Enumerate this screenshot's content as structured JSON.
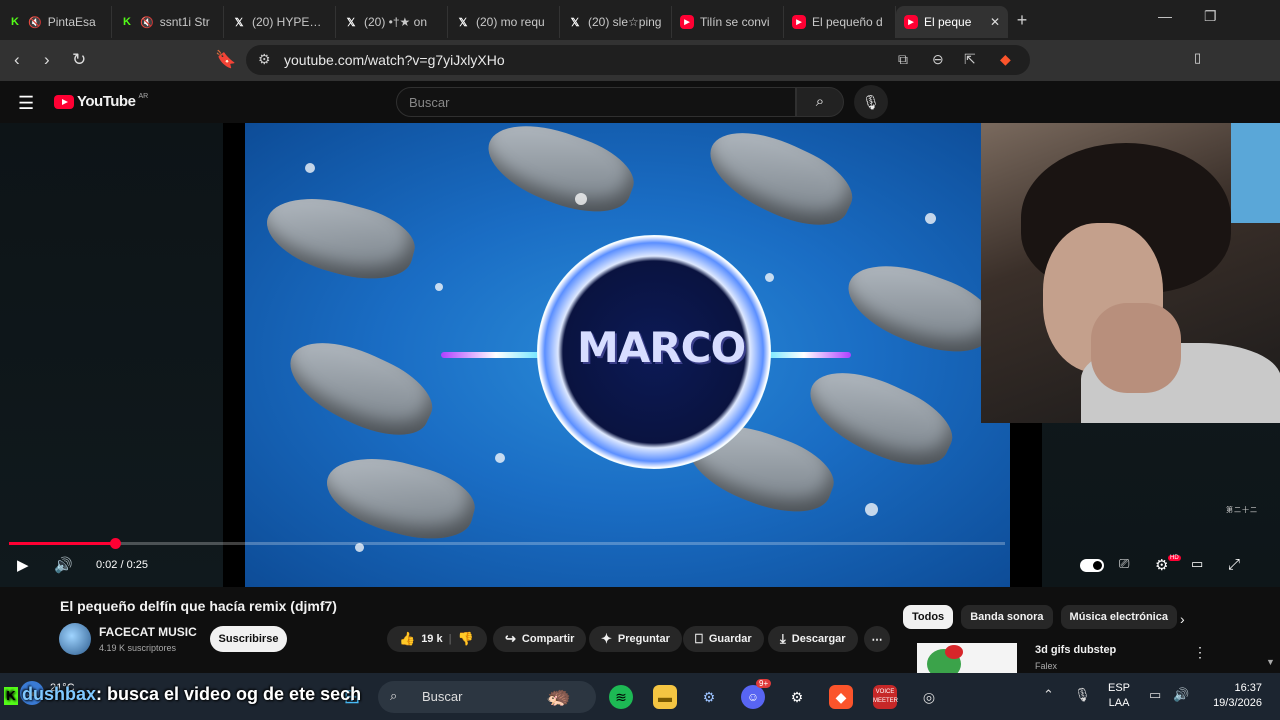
{
  "browser": {
    "tabs": [
      {
        "title": "PintaEsa",
        "favicon": "kick",
        "muted": true
      },
      {
        "title": "ssnt1i Str",
        "favicon": "kick",
        "muted": true
      },
      {
        "title": "(20) HYPEX o",
        "favicon": "x"
      },
      {
        "title": "(20) •†★ on",
        "favicon": "x"
      },
      {
        "title": "(20) mo requ",
        "favicon": "x"
      },
      {
        "title": "(20) sle☆ping",
        "favicon": "x"
      },
      {
        "title": "Tilín se convi",
        "favicon": "youtube"
      },
      {
        "title": "El pequeño d",
        "favicon": "youtube"
      },
      {
        "title": "El peque",
        "favicon": "youtube",
        "active": true
      }
    ],
    "url": "youtube.com/watch?v=g7yiJxlyXHo",
    "extension_badge": "8"
  },
  "youtube": {
    "logo_text": "YouTube",
    "country": "AR",
    "search_placeholder": "Buscar"
  },
  "player": {
    "overlay_logo_text": "MARCO",
    "time": "0:02 / 0:25",
    "progress_fraction": 0.106,
    "watermark": "第二十二",
    "settings_badge": "HD"
  },
  "video": {
    "title": "El pequeño delfín que hacía remix (djmf7)",
    "channel": "FACECAT MUSIC",
    "subscribers": "4.19 K suscriptores",
    "subscribe_label": "Suscribirse",
    "likes": "19 k",
    "share_label": "Compartir",
    "ask_label": "Preguntar",
    "save_label": "Guardar",
    "download_label": "Descargar"
  },
  "recommendations": {
    "chips": [
      "Todos",
      "Banda sonora",
      "Música electrónica"
    ],
    "first": {
      "title": "3d gifs dubstep",
      "channel": "Falex"
    }
  },
  "taskbar": {
    "temperature": "21°C",
    "search_placeholder": "Buscar",
    "discord_badge": "9+",
    "voicemeeter_label": "VOICE MEETER",
    "lang_top": "ESP",
    "lang_bottom": "LAA",
    "time": "16:37",
    "date": "19/3/2026"
  },
  "chat_overlay": {
    "username": "dushbax",
    "message": ": busca el video og de ete sech"
  }
}
